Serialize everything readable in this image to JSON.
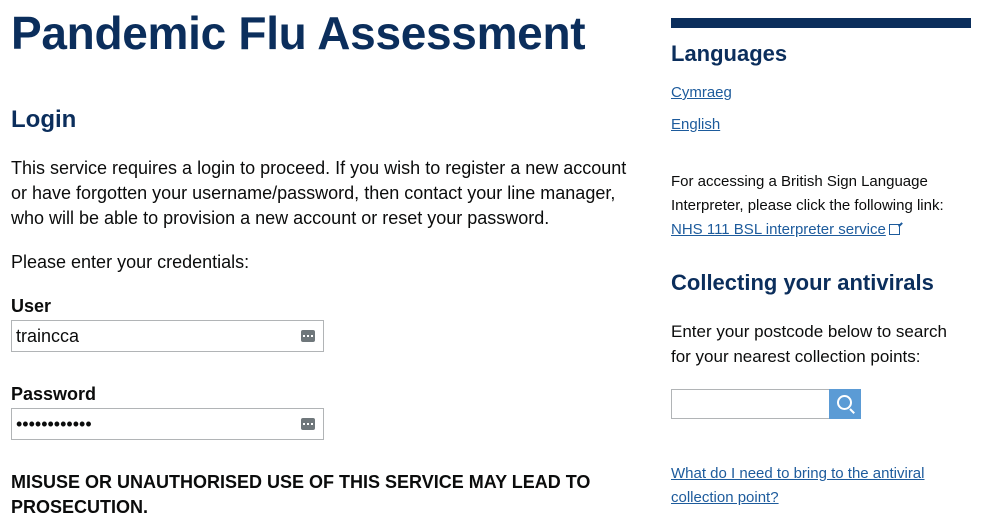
{
  "header": {
    "title": "Pandemic Flu Assessment"
  },
  "login": {
    "heading": "Login",
    "intro": "This service requires a login to proceed. If you wish to register a new account or have forgotten your username/password, then contact your line manager, who will be able to provision a new account or reset your password.",
    "prompt": "Please enter your credentials:",
    "user_label": "User",
    "user_value": "traincca",
    "password_label": "Password",
    "password_value": "••••••••••••",
    "field_icon": "password-manager-icon",
    "warning": "MISUSE OR UNAUTHORISED USE OF THIS SERVICE MAY LEAD TO PROSECUTION."
  },
  "sidebar": {
    "languages_heading": "Languages",
    "languages": [
      "Cymraeg",
      "English"
    ],
    "bsl_text": "For accessing a British Sign Language Interpreter, please click the following link:",
    "bsl_link": "NHS 111 BSL interpreter service",
    "bsl_icon": "external-link-icon",
    "antivirals_heading": "Collecting your antivirals",
    "antivirals_text": "Enter your postcode below to search for your nearest collection points:",
    "postcode_value": "",
    "search_icon": "search-icon",
    "bring_link": "What do I need to bring to the antiviral collection point?"
  },
  "colors": {
    "heading": "#0b2e5c",
    "link": "#1d5b9c",
    "search_button": "#5b9bd5"
  }
}
